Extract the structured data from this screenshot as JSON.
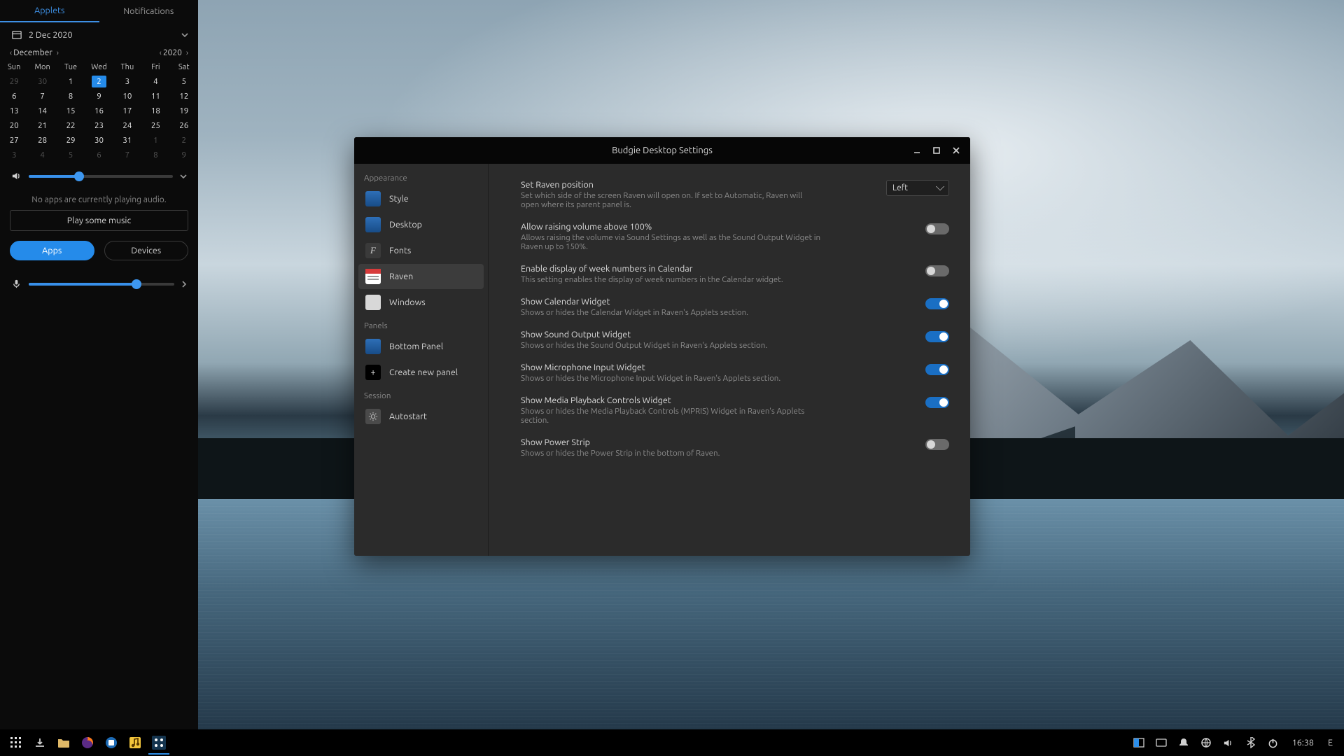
{
  "raven": {
    "tabs": {
      "applets": "Applets",
      "notifications": "Notifications",
      "active": "applets"
    },
    "date_display": "2 Dec 2020",
    "month_label": "December",
    "year_label": "2020",
    "dow": [
      "Sun",
      "Mon",
      "Tue",
      "Wed",
      "Thu",
      "Fri",
      "Sat"
    ],
    "weeks": [
      [
        {
          "n": 29,
          "o": true
        },
        {
          "n": 30,
          "o": true
        },
        {
          "n": 1
        },
        {
          "n": 2,
          "today": true
        },
        {
          "n": 3
        },
        {
          "n": 4
        },
        {
          "n": 5
        }
      ],
      [
        {
          "n": 6
        },
        {
          "n": 7
        },
        {
          "n": 8
        },
        {
          "n": 9
        },
        {
          "n": 10
        },
        {
          "n": 11
        },
        {
          "n": 12
        }
      ],
      [
        {
          "n": 13
        },
        {
          "n": 14
        },
        {
          "n": 15
        },
        {
          "n": 16
        },
        {
          "n": 17
        },
        {
          "n": 18
        },
        {
          "n": 19
        }
      ],
      [
        {
          "n": 20
        },
        {
          "n": 21
        },
        {
          "n": 22
        },
        {
          "n": 23
        },
        {
          "n": 24
        },
        {
          "n": 25
        },
        {
          "n": 26
        }
      ],
      [
        {
          "n": 27
        },
        {
          "n": 28
        },
        {
          "n": 29
        },
        {
          "n": 30
        },
        {
          "n": 31
        },
        {
          "n": 1,
          "o": true
        },
        {
          "n": 2,
          "o": true
        }
      ],
      [
        {
          "n": 3,
          "o": true
        },
        {
          "n": 4,
          "o": true
        },
        {
          "n": 5,
          "o": true
        },
        {
          "n": 6,
          "o": true
        },
        {
          "n": 7,
          "o": true
        },
        {
          "n": 8,
          "o": true
        },
        {
          "n": 9,
          "o": true
        }
      ]
    ],
    "volume_pct": 35,
    "mic_pct": 74,
    "no_audio_msg": "No apps are currently playing audio.",
    "play_label": "Play some music",
    "pill_apps": "Apps",
    "pill_devices": "Devices"
  },
  "settings": {
    "title": "Budgie Desktop Settings",
    "sections": {
      "appearance": "Appearance",
      "panels": "Panels",
      "session": "Session"
    },
    "items": {
      "style": "Style",
      "desktop": "Desktop",
      "fonts": "Fonts",
      "raven": "Raven",
      "windows": "Windows",
      "bottom_panel": "Bottom Panel",
      "create_panel": "Create new panel",
      "autostart": "Autostart"
    },
    "selected_item": "raven",
    "rows": [
      {
        "key": "position",
        "title": "Set Raven position",
        "sub": "Set which side of the screen Raven will open on. If set to Automatic, Raven will open where its parent panel is.",
        "control": "combo",
        "value": "Left"
      },
      {
        "key": "volume150",
        "title": "Allow raising volume above 100%",
        "sub": "Allows raising the volume via Sound Settings as well as the Sound Output Widget in Raven up to 150%.",
        "control": "toggle",
        "value": false
      },
      {
        "key": "weeknum",
        "title": "Enable display of week numbers in Calendar",
        "sub": "This setting enables the display of week numbers in the Calendar widget.",
        "control": "toggle",
        "value": false
      },
      {
        "key": "calwidget",
        "title": "Show Calendar Widget",
        "sub": "Shows or hides the Calendar Widget in Raven's Applets section.",
        "control": "toggle",
        "value": true
      },
      {
        "key": "sndout",
        "title": "Show Sound Output Widget",
        "sub": "Shows or hides the Sound Output Widget in Raven's Applets section.",
        "control": "toggle",
        "value": true
      },
      {
        "key": "micin",
        "title": "Show Microphone Input Widget",
        "sub": "Shows or hides the Microphone Input Widget in Raven's Applets section.",
        "control": "toggle",
        "value": true
      },
      {
        "key": "mpris",
        "title": "Show Media Playback Controls Widget",
        "sub": "Shows or hides the Media Playback Controls (MPRIS) Widget in Raven's Applets section.",
        "control": "toggle",
        "value": true
      },
      {
        "key": "powerstrip",
        "title": "Show Power Strip",
        "sub": "Shows or hides the Power Strip in the bottom of Raven.",
        "control": "toggle",
        "value": false
      }
    ]
  },
  "taskbar": {
    "clock": "16:38",
    "launchers": [
      {
        "name": "apps-menu",
        "icon": "grid",
        "accent": "#fff"
      },
      {
        "name": "downloads",
        "icon": "download",
        "accent": "#9aa"
      },
      {
        "name": "files",
        "icon": "files",
        "accent": "#e0b967"
      },
      {
        "name": "firefox",
        "icon": "firefox",
        "accent": "#ff7b1a"
      },
      {
        "name": "software",
        "icon": "software",
        "accent": "#2d8fea"
      },
      {
        "name": "rhythmbox",
        "icon": "music",
        "accent": "#f2c53c"
      },
      {
        "name": "budgie-settings",
        "icon": "budgie",
        "accent": "#2d8fea",
        "active": true
      }
    ],
    "tray": [
      {
        "name": "workspace-indicator",
        "icon": "workspace"
      },
      {
        "name": "keyboard-layout",
        "icon": "keyboard"
      },
      {
        "name": "notifications-indicator",
        "icon": "bell"
      },
      {
        "name": "network-indicator",
        "icon": "network"
      },
      {
        "name": "volume-indicator",
        "icon": "volume"
      },
      {
        "name": "bluetooth-indicator",
        "icon": "bluetooth"
      },
      {
        "name": "power-indicator",
        "icon": "power"
      }
    ],
    "end_label": "E"
  }
}
